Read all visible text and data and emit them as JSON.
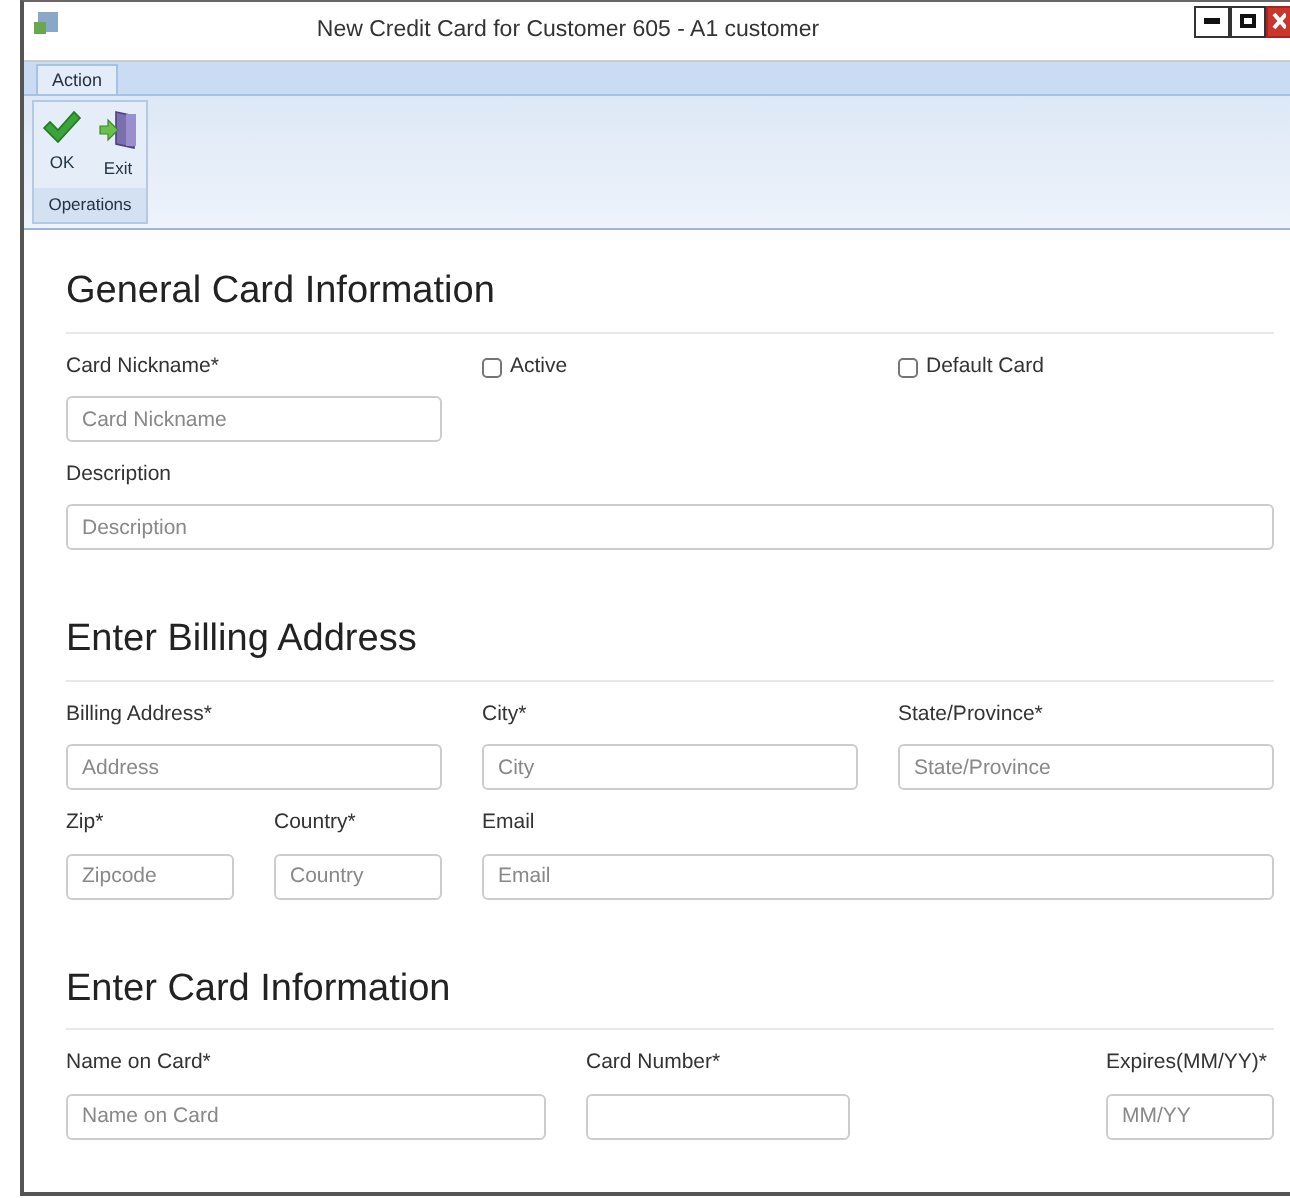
{
  "window": {
    "title": "New Credit Card for Customer 605 - A1 customer"
  },
  "ribbon": {
    "tabs": [
      {
        "label": "Action",
        "selected": true
      }
    ],
    "groups": [
      {
        "name": "Operations",
        "buttons": [
          {
            "label": "OK",
            "kind": "ok"
          },
          {
            "label": "Exit",
            "kind": "exit"
          }
        ]
      }
    ]
  },
  "sections": [
    {
      "heading": "General Card Information",
      "lines": [
        {
          "fields": [
            {
              "kind": "input",
              "label": "Card Nickname*",
              "placeholder": "Card Nickname"
            },
            {
              "kind": "checkbox",
              "label": "Active",
              "checked": false
            },
            {
              "kind": "checkbox",
              "label": "Default Card",
              "checked": false
            }
          ]
        },
        {
          "fields": [
            {
              "kind": "input",
              "label": "Description",
              "placeholder": "Description"
            }
          ]
        }
      ]
    },
    {
      "heading": "Enter Billing Address",
      "lines": [
        {
          "fields": [
            {
              "kind": "input",
              "label": "Billing Address*",
              "placeholder": "Address"
            },
            {
              "kind": "input",
              "label": "City*",
              "placeholder": "City"
            },
            {
              "kind": "input",
              "label": "State/Province*",
              "placeholder": "State/Province"
            }
          ]
        },
        {
          "fields": [
            {
              "kind": "input",
              "label": "Zip*",
              "placeholder": "Zipcode"
            },
            {
              "kind": "input",
              "label": "Country*",
              "placeholder": "Country"
            },
            {
              "kind": "input",
              "label": "Email",
              "placeholder": "Email"
            }
          ]
        }
      ]
    },
    {
      "heading": "Enter Card Information",
      "lines": [
        {
          "fields": [
            {
              "kind": "input",
              "label": "Name on Card*",
              "placeholder": "Name on Card"
            },
            {
              "kind": "input",
              "label": "Card Number*"
            },
            {
              "kind": "input",
              "label": "Expires(MM/YY)*",
              "placeholder": "MM/YY"
            }
          ]
        }
      ]
    }
  ]
}
